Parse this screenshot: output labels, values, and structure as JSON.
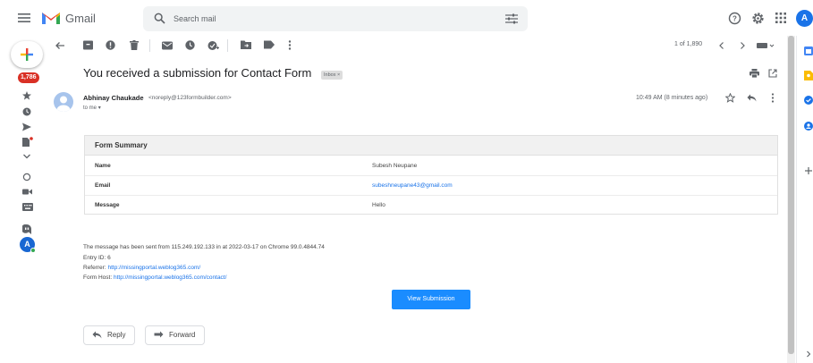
{
  "header": {
    "app_name": "Gmail",
    "search_placeholder": "Search mail",
    "account_initial": "A"
  },
  "sidebar": {
    "unread_count": "1,786",
    "chat_avatar_initial": "A"
  },
  "toolbar": {
    "pager": "1 of 1,890"
  },
  "message": {
    "subject": "You received a submission for Contact Form",
    "label": "Inbox",
    "sender_name": "Abhinay Chaukade",
    "sender_email": "noreply@123formbuilder.com",
    "to": "to me",
    "time": "10:49 AM (8 minutes ago)"
  },
  "form_summary": {
    "title": "Form Summary",
    "rows": [
      {
        "label": "Name",
        "value": "Subesh Neupane"
      },
      {
        "label": "Email",
        "value": "subeshneupane43@gmail.com"
      },
      {
        "label": "Message",
        "value": "Hello"
      }
    ]
  },
  "meta": {
    "sent_line": "The message has been sent from 115.249.192.133 in at 2022-03-17 on Chrome 99.0.4844.74",
    "entry_id": "Entry ID: 6",
    "referrer_label": "Referrer:",
    "referrer_url": "http://missingportal.weblog365.com/",
    "form_host_label": "Form Host:",
    "form_host_url": "http://missingportal.weblog365.com/contact/"
  },
  "actions": {
    "view_submission": "View Submission",
    "reply": "Reply",
    "forward": "Forward"
  },
  "colors": {
    "gmail_red": "#ea4335",
    "badge_red": "#d93025",
    "link_blue": "#1a73e8",
    "button_blue": "#1a8cff",
    "account_blue": "#1a73e8"
  }
}
